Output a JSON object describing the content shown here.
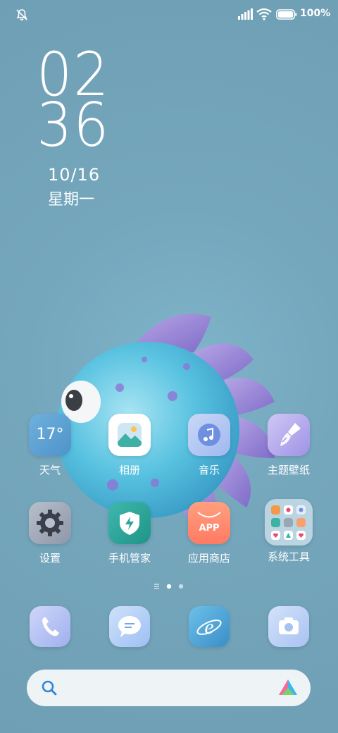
{
  "status_bar": {
    "battery_percent": "100%",
    "battery_level": 1.0,
    "icons": [
      "mute-icon",
      "signal-icon",
      "wifi-icon",
      "battery-icon"
    ]
  },
  "clock": {
    "hours": "02",
    "minutes": "36",
    "date": "10/16",
    "weekday": "星期一"
  },
  "weather": {
    "temp": "17°"
  },
  "apps_row1": [
    {
      "label": "天气",
      "icon": "weather-icon"
    },
    {
      "label": "相册",
      "icon": "gallery-icon"
    },
    {
      "label": "音乐",
      "icon": "music-icon"
    },
    {
      "label": "主题壁纸",
      "icon": "theme-brush-icon"
    }
  ],
  "apps_row2": [
    {
      "label": "设置",
      "icon": "gear-icon"
    },
    {
      "label": "手机管家",
      "icon": "security-shield-icon"
    },
    {
      "label": "应用商店",
      "icon": "app-store-icon",
      "badge_text": "APP"
    },
    {
      "label": "系统工具",
      "icon": "folder-icon"
    }
  ],
  "page_indicator": {
    "pages": 2,
    "current": 1
  },
  "dock": [
    {
      "name": "phone",
      "icon": "phone-icon"
    },
    {
      "name": "messages",
      "icon": "message-icon"
    },
    {
      "name": "browser",
      "icon": "browser-icon"
    },
    {
      "name": "camera",
      "icon": "camera-icon"
    }
  ],
  "search": {
    "icon": "search-icon",
    "assistant_icon": "assistant-logo-icon"
  },
  "colors": {
    "wallpaper": "#74a6bc",
    "settings_bg": "#5c6478",
    "security_bg": "#2aa39a",
    "appstore_bg": "#ff8a70",
    "folder_bg": "#c7dbe5"
  }
}
